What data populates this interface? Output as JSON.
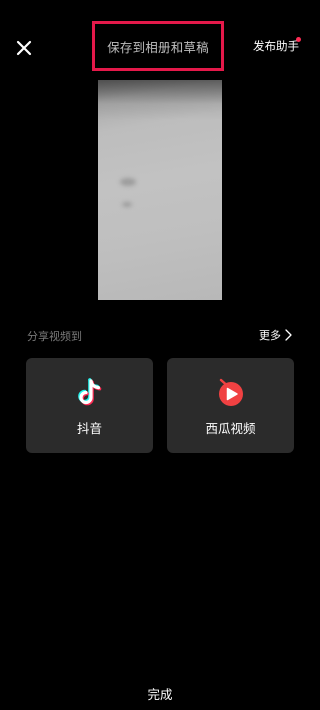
{
  "header": {
    "close_icon": "close-icon",
    "title": "保存到相册和草稿",
    "publish_helper": "发布助手",
    "highlight_color": "#e5194a",
    "notification_dot_color": "#fe2c55"
  },
  "share": {
    "label": "分享视频到",
    "more": "更多",
    "more_icon": "chevron-right-icon",
    "targets": [
      {
        "label": "抖音",
        "icon": "douyin-logo-icon"
      },
      {
        "label": "西瓜视频",
        "icon": "xigua-video-logo-icon",
        "color": "#f04142"
      }
    ]
  },
  "footer": {
    "done": "完成"
  }
}
